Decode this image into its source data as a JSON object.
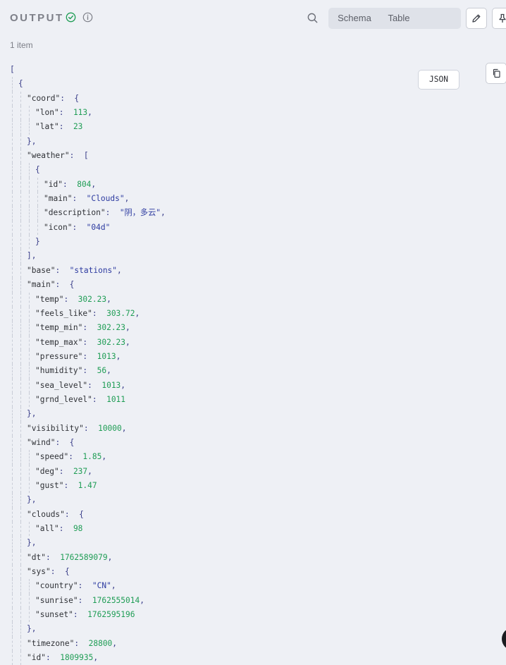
{
  "header": {
    "title": "OUTPUT",
    "tabs": [
      {
        "label": "Schema",
        "active": false
      },
      {
        "label": "Table",
        "active": false
      },
      {
        "label": "JSON",
        "active": true
      }
    ],
    "icons": [
      "check-circle-icon",
      "info-icon",
      "search-icon",
      "pencil-icon",
      "pin-icon",
      "copy-icon"
    ],
    "accent_ok": "#1f9d55"
  },
  "item_count": "1 item",
  "json_lines": [
    {
      "d": 0,
      "t": "p",
      "p": "["
    },
    {
      "d": 1,
      "t": "p",
      "p": "{"
    },
    {
      "d": 2,
      "t": "o",
      "k": "coord",
      "p": "{"
    },
    {
      "d": 3,
      "t": "v",
      "k": "lon",
      "v": "113",
      "vt": "n",
      "c": true
    },
    {
      "d": 3,
      "t": "v",
      "k": "lat",
      "v": "23",
      "vt": "n",
      "c": false
    },
    {
      "d": 2,
      "t": "p",
      "p": "},"
    },
    {
      "d": 2,
      "t": "o",
      "k": "weather",
      "p": "["
    },
    {
      "d": 3,
      "t": "p",
      "p": "{"
    },
    {
      "d": 4,
      "t": "v",
      "k": "id",
      "v": "804",
      "vt": "n",
      "c": true
    },
    {
      "d": 4,
      "t": "v",
      "k": "main",
      "v": "\"Clouds\"",
      "vt": "s",
      "c": true
    },
    {
      "d": 4,
      "t": "v",
      "k": "description",
      "v": "\"阴，多云\"",
      "vt": "s",
      "c": true
    },
    {
      "d": 4,
      "t": "v",
      "k": "icon",
      "v": "\"04d\"",
      "vt": "s",
      "c": false
    },
    {
      "d": 3,
      "t": "p",
      "p": "}"
    },
    {
      "d": 2,
      "t": "p",
      "p": "],"
    },
    {
      "d": 2,
      "t": "v",
      "k": "base",
      "v": "\"stations\"",
      "vt": "s",
      "c": true
    },
    {
      "d": 2,
      "t": "o",
      "k": "main",
      "p": "{"
    },
    {
      "d": 3,
      "t": "v",
      "k": "temp",
      "v": "302.23",
      "vt": "n",
      "c": true
    },
    {
      "d": 3,
      "t": "v",
      "k": "feels_like",
      "v": "303.72",
      "vt": "n",
      "c": true
    },
    {
      "d": 3,
      "t": "v",
      "k": "temp_min",
      "v": "302.23",
      "vt": "n",
      "c": true
    },
    {
      "d": 3,
      "t": "v",
      "k": "temp_max",
      "v": "302.23",
      "vt": "n",
      "c": true
    },
    {
      "d": 3,
      "t": "v",
      "k": "pressure",
      "v": "1013",
      "vt": "n",
      "c": true
    },
    {
      "d": 3,
      "t": "v",
      "k": "humidity",
      "v": "56",
      "vt": "n",
      "c": true
    },
    {
      "d": 3,
      "t": "v",
      "k": "sea_level",
      "v": "1013",
      "vt": "n",
      "c": true
    },
    {
      "d": 3,
      "t": "v",
      "k": "grnd_level",
      "v": "1011",
      "vt": "n",
      "c": false
    },
    {
      "d": 2,
      "t": "p",
      "p": "},"
    },
    {
      "d": 2,
      "t": "v",
      "k": "visibility",
      "v": "10000",
      "vt": "n",
      "c": true
    },
    {
      "d": 2,
      "t": "o",
      "k": "wind",
      "p": "{"
    },
    {
      "d": 3,
      "t": "v",
      "k": "speed",
      "v": "1.85",
      "vt": "n",
      "c": true
    },
    {
      "d": 3,
      "t": "v",
      "k": "deg",
      "v": "237",
      "vt": "n",
      "c": true
    },
    {
      "d": 3,
      "t": "v",
      "k": "gust",
      "v": "1.47",
      "vt": "n",
      "c": false
    },
    {
      "d": 2,
      "t": "p",
      "p": "},"
    },
    {
      "d": 2,
      "t": "o",
      "k": "clouds",
      "p": "{"
    },
    {
      "d": 3,
      "t": "v",
      "k": "all",
      "v": "98",
      "vt": "n",
      "c": false
    },
    {
      "d": 2,
      "t": "p",
      "p": "},"
    },
    {
      "d": 2,
      "t": "v",
      "k": "dt",
      "v": "1762589079",
      "vt": "n",
      "c": true
    },
    {
      "d": 2,
      "t": "o",
      "k": "sys",
      "p": "{"
    },
    {
      "d": 3,
      "t": "v",
      "k": "country",
      "v": "\"CN\"",
      "vt": "s",
      "c": true
    },
    {
      "d": 3,
      "t": "v",
      "k": "sunrise",
      "v": "1762555014",
      "vt": "n",
      "c": true
    },
    {
      "d": 3,
      "t": "v",
      "k": "sunset",
      "v": "1762595196",
      "vt": "n",
      "c": false
    },
    {
      "d": 2,
      "t": "p",
      "p": "},"
    },
    {
      "d": 2,
      "t": "v",
      "k": "timezone",
      "v": "28800",
      "vt": "n",
      "c": true
    },
    {
      "d": 2,
      "t": "v",
      "k": "id",
      "v": "1809935",
      "vt": "n",
      "c": true
    }
  ]
}
